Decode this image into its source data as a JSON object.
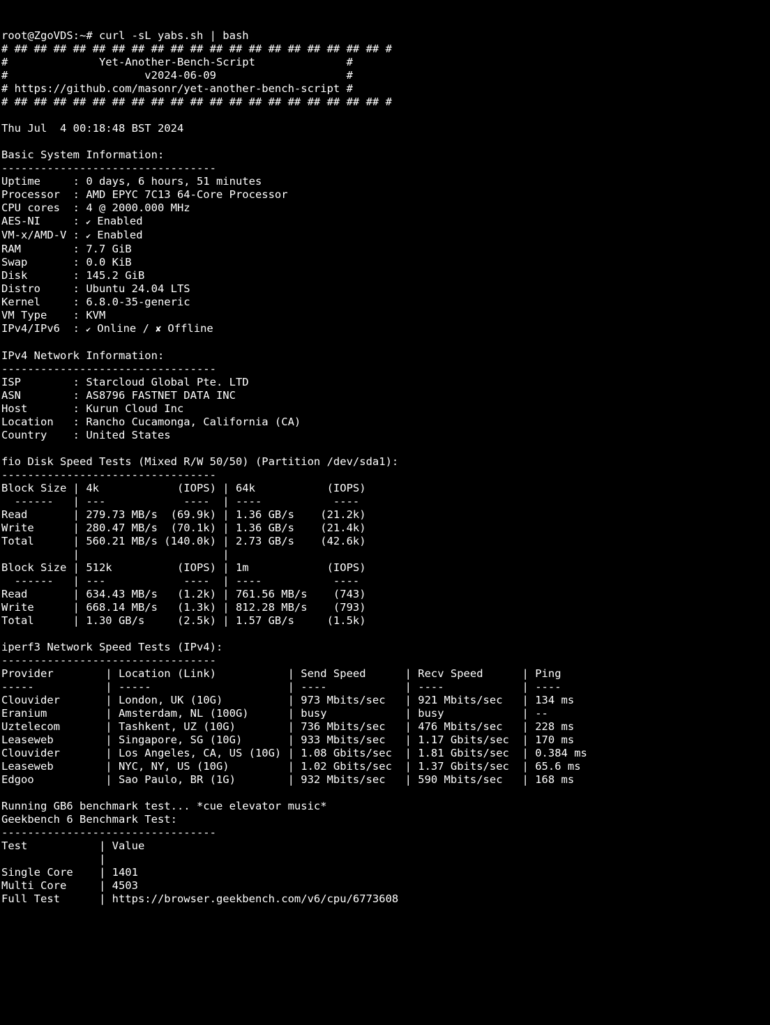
{
  "prompt": "root@ZgoVDS:~# curl -sL yabs.sh | bash",
  "banner": {
    "border": "# ## ## ## ## ## ## ## ## ## ## ## ## ## ## ## ## ## ## ## #",
    "title": "#              Yet-Another-Bench-Script              #",
    "version": "#                     v2024-06-09                    #",
    "url": "# https://github.com/masonr/yet-another-bench-script #"
  },
  "timestamp": "Thu Jul  4 00:18:48 BST 2024",
  "basic_header": "Basic System Information:",
  "basic_divider": "---------------------------------",
  "basic": {
    "uptime": "Uptime     : 0 days, 6 hours, 51 minutes",
    "processor": "Processor  : AMD EPYC 7C13 64-Core Processor",
    "cores": "CPU cores  : 4 @ 2000.000 MHz",
    "aesni_l": "AES-NI     : ",
    "aesni_v": " Enabled",
    "vmx_l": "VM-x/AMD-V : ",
    "vmx_v": " Enabled",
    "ram": "RAM        : 7.7 GiB",
    "swap": "Swap       : 0.0 KiB",
    "disk": "Disk       : 145.2 GiB",
    "distro": "Distro     : Ubuntu 24.04 LTS",
    "kernel": "Kernel     : 6.8.0-35-generic",
    "vmtype": "VM Type    : KVM",
    "ip_l": "IPv4/IPv6  : ",
    "ip_on": " Online / ",
    "ip_off": " Offline"
  },
  "net_header": "IPv4 Network Information:",
  "net_divider": "---------------------------------",
  "net": {
    "isp": "ISP        : Starcloud Global Pte. LTD",
    "asn": "ASN        : AS8796 FASTNET DATA INC",
    "host": "Host       : Kurun Cloud Inc",
    "location": "Location   : Rancho Cucamonga, California (CA)",
    "country": "Country    : United States"
  },
  "fio_header": "fio Disk Speed Tests (Mixed R/W 50/50) (Partition /dev/sda1):",
  "fio_divider": "---------------------------------",
  "fio1": {
    "hdr": "Block Size | 4k            (IOPS) | 64k           (IOPS)",
    "div": "  ------   | ---            ----  | ----           ---- ",
    "read": "Read       | 279.73 MB/s  (69.9k) | 1.36 GB/s    (21.2k)",
    "write": "Write      | 280.47 MB/s  (70.1k) | 1.36 GB/s    (21.4k)",
    "total": "Total      | 560.21 MB/s (140.0k) | 2.73 GB/s    (42.6k)",
    "blank": "           |                      |                     "
  },
  "fio2": {
    "hdr": "Block Size | 512k          (IOPS) | 1m            (IOPS)",
    "div": "  ------   | ---            ----  | ----           ---- ",
    "read": "Read       | 634.43 MB/s   (1.2k) | 761.56 MB/s    (743)",
    "write": "Write      | 668.14 MB/s   (1.3k) | 812.28 MB/s    (793)",
    "total": "Total      | 1.30 GB/s     (2.5k) | 1.57 GB/s     (1.5k)"
  },
  "iperf_header": "iperf3 Network Speed Tests (IPv4):",
  "iperf_divider": "---------------------------------",
  "iperf": {
    "hdr": "Provider        | Location (Link)           | Send Speed      | Recv Speed      | Ping   ",
    "div": "-----           | -----                     | ----            | ----            | ----   ",
    "r1": "Clouvider       | London, UK (10G)          | 973 Mbits/sec   | 921 Mbits/sec   | 134 ms ",
    "r2": "Eranium         | Amsterdam, NL (100G)      | busy            | busy            | -- ",
    "r3": "Uztelecom       | Tashkent, UZ (10G)        | 736 Mbits/sec   | 476 Mbits/sec   | 228 ms ",
    "r4": "Leaseweb        | Singapore, SG (10G)       | 933 Mbits/sec   | 1.17 Gbits/sec  | 170 ms ",
    "r5": "Clouvider       | Los Angeles, CA, US (10G) | 1.08 Gbits/sec  | 1.81 Gbits/sec  | 0.384 ms ",
    "r6": "Leaseweb        | NYC, NY, US (10G)         | 1.02 Gbits/sec  | 1.37 Gbits/sec  | 65.6 ms ",
    "r7": "Edgoo           | Sao Paulo, BR (1G)        | 932 Mbits/sec   | 590 Mbits/sec   | 168 ms "
  },
  "gb": {
    "running": "Running GB6 benchmark test... *cue elevator music*",
    "header": "Geekbench 6 Benchmark Test:",
    "divider": "---------------------------------",
    "hdr": "Test           | Value",
    "blank": "               |                ",
    "single": "Single Core    | 1401",
    "multi": "Multi Core     | 4503",
    "full": "Full Test      | https://browser.geekbench.com/v6/cpu/6773608"
  }
}
